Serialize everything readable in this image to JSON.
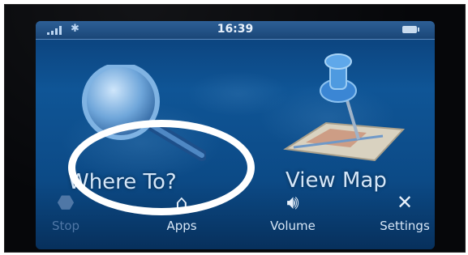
{
  "status_bar": {
    "time": "16:39",
    "icons": [
      "signal-icon",
      "bluetooth-icon",
      "battery-icon"
    ]
  },
  "main_menu": {
    "where_to": {
      "label": "Where To?",
      "icon": "magnifier-icon"
    },
    "view_map": {
      "label": "View Map",
      "icon": "map-pin-icon"
    }
  },
  "bottom_bar": {
    "stop": {
      "label": "Stop",
      "icon": "stop-icon",
      "enabled": false
    },
    "apps": {
      "label": "Apps",
      "icon": "apps-icon"
    },
    "volume": {
      "label": "Volume",
      "icon": "speaker-icon"
    },
    "settings": {
      "label": "Settings",
      "icon": "wrench-screwdriver-icon"
    }
  },
  "annotation": {
    "highlight_color": "#ffffff",
    "shape": "ellipse"
  },
  "colors": {
    "screen_blue": "#0f5596",
    "label_text": "#d4e6f8"
  }
}
